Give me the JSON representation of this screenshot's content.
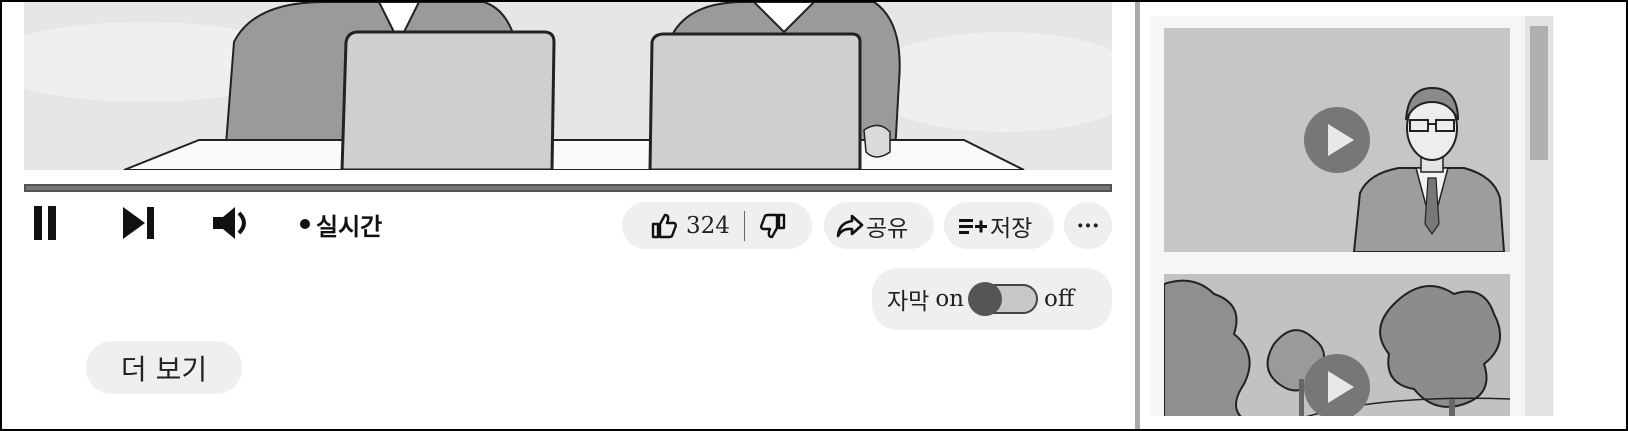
{
  "player": {
    "live_label": "실시간",
    "progress_fraction": 1.0
  },
  "actions": {
    "like_count": "324",
    "share_label": "공유",
    "save_label": "저장",
    "more_label": "···"
  },
  "subtitles": {
    "label": "자막",
    "on_label": "on",
    "off_label": "off",
    "state": "on"
  },
  "description": {
    "show_more_label": "더 보기"
  },
  "icons": [
    "pause-icon",
    "skip-next-icon",
    "volume-icon",
    "thumbs-up-icon",
    "thumbs-down-icon",
    "share-arrow-icon",
    "playlist-add-icon",
    "more-icon",
    "play-icon"
  ],
  "colors": {
    "track": "#555555",
    "fill": "#777777",
    "pill_bg": "#efefef"
  }
}
